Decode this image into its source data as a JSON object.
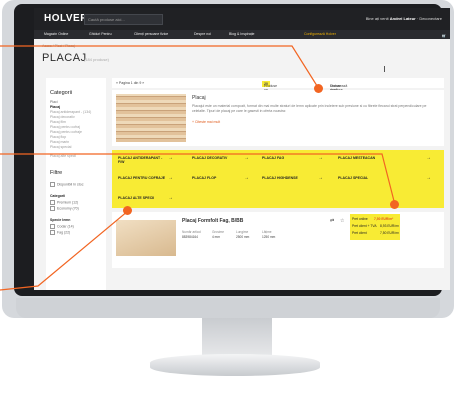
{
  "header": {
    "logo": "HOLVER",
    "search_placeholder": "Caută produse aici...",
    "account_prefix": "Bine ați venit",
    "account_name": "Andrei Lateur",
    "logout": "Deconectare"
  },
  "nav": {
    "items": [
      "Magazin Online",
      "Ghiduri Pentru",
      "Clienți persoane fizice",
      "Despre noi",
      "Blog & Inspirație"
    ],
    "config": "Configurează Holver"
  },
  "breadcrumb": "Acasa / Placi / Placaj",
  "page": {
    "title": "PLACAJ",
    "count": "(184 produse)"
  },
  "sidebar": {
    "categories_title": "Categorii",
    "all_label": "Placi",
    "subcat": "Placaj",
    "subitems": [
      "Placaj antiderapant - (134)",
      "Placaj decorativ",
      "Placaj film",
      "Placaj pentru cofraj",
      "Placaj pentru cofraje",
      "Placaj flop",
      "Placaj marin",
      "Placaj special",
      "Placaj alte specii"
    ],
    "filter_title": "Filtre",
    "filter_option": "Disponibil în stoc",
    "category_title": "Categorii",
    "cat_options": [
      "Premium (12)",
      "Economy (70)"
    ],
    "species_title": "Specie lemn",
    "species_options": [
      "Codar (14)",
      "Fag (22)"
    ]
  },
  "toolbar": {
    "pagination": "« Pagina 1 din 9 »",
    "per_page_label": "Produse pe pagina",
    "per_page_value": "20",
    "sort_label": "Ordonează după",
    "sort_value": "Numar produse crescător"
  },
  "banner": {
    "title": "Placaj",
    "desc": "Placajul este un material compozit, format din mai multe straturi de lemn aplicate prin incleiere sub presiune si cu fibrele fiecarui strat perpendiculare pe celelalte. Tipuri de placaj pe care le gasesti in oferta noastra:",
    "link": "+ Citeste mai mult"
  },
  "grid": {
    "items": [
      "PLACAJ ANTIDERAPANT - F/W",
      "PLACAJ DECORATIV",
      "PLACAJ FAG",
      "PLACAJ MESTEACAN",
      "PLACAJ PENTRU COFRAJE",
      "PLACAJ FLOP",
      "PLACAJ HIGHDENSE",
      "PLACAJ SPECIAL",
      "PLACAJ ALTE SPECII"
    ],
    "arrow": "→"
  },
  "product": {
    "title": "Placaj Formfolt Fag, B/BB",
    "specs": [
      "Număr articol",
      "Grosime",
      "Lungime",
      "Lățime"
    ],
    "specs_values": [
      "883984164",
      "4 mm",
      "2500 mm",
      "1250 mm"
    ],
    "price_main": "7,50 EUR/m²",
    "price_label_1": "Pret online",
    "price_label_2": "Pret client + TVA",
    "price_label_3": "Pret client",
    "price_2": "8,93 EUR/m²",
    "price_3": "7,50 EUR/m²"
  },
  "colors": {
    "accent": "#f8eb34",
    "orange": "#f26522",
    "dark": "#202124"
  }
}
